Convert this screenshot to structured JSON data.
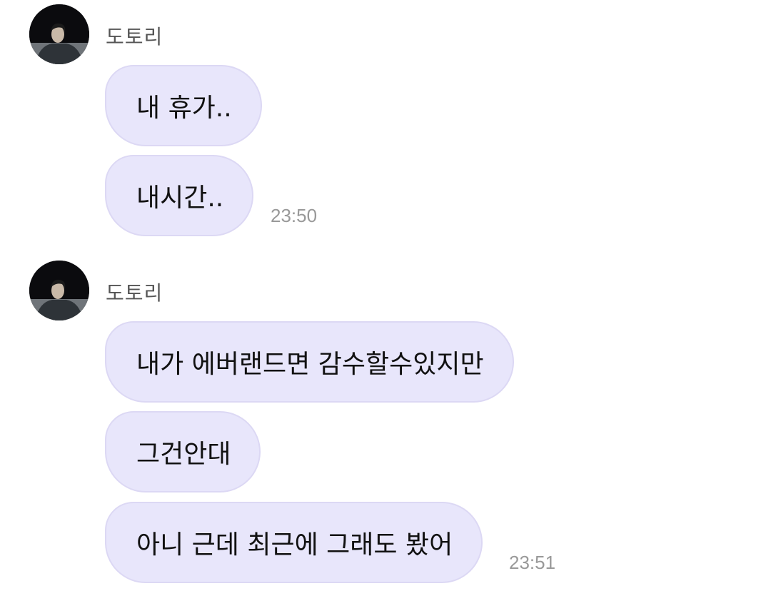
{
  "groups": [
    {
      "sender": "도토리",
      "messages": [
        "내 휴가..",
        "내시간.."
      ],
      "time": "23:50"
    },
    {
      "sender": "도토리",
      "messages": [
        "내가 에버랜드면 감수할수있지만",
        "그건안대",
        "아니 근데 최근에 그래도 봤어"
      ],
      "time": "23:51"
    }
  ],
  "icons": {
    "avatar": "profile-photo-avatar"
  },
  "colors": {
    "bubble": "#e8e6fb",
    "bubble_border": "#dcd8f4",
    "time": "#999999",
    "sender": "#555555"
  }
}
